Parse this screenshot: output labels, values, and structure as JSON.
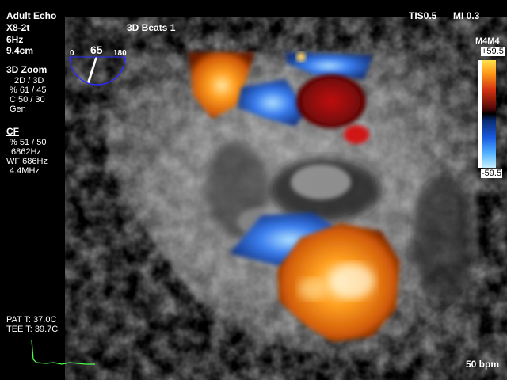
{
  "header": {
    "mode": "Adult Echo",
    "probe": "X8-2t",
    "freq": "6Hz",
    "depth": "9.4cm",
    "beats": "3D Beats 1",
    "tis": "TIS0.5",
    "mi": "MI 0.3"
  },
  "zoom": {
    "title": "3D Zoom",
    "lines": [
      "2D / 3D",
      "% 61 / 45",
      "C  50 / 30",
      "Gen"
    ]
  },
  "cf": {
    "title": "CF",
    "lines": [
      "% 51 / 50",
      "6862Hz",
      "WF 686Hz",
      "4.4MHz"
    ]
  },
  "gauge": {
    "min": "0",
    "value": "65",
    "max": "180",
    "angle_deg": 65
  },
  "colormap": {
    "name": "M4M4",
    "top": "+59.5",
    "bottom": "-59.5"
  },
  "temps": {
    "pat": "PAT T: 37.0C",
    "tee": "TEE T: 39.7C"
  },
  "heart_rate": "50 bpm",
  "colors": {
    "ecg": "#4cff4c",
    "text": "#ffffff",
    "gauge_line": "#2a2aff"
  }
}
